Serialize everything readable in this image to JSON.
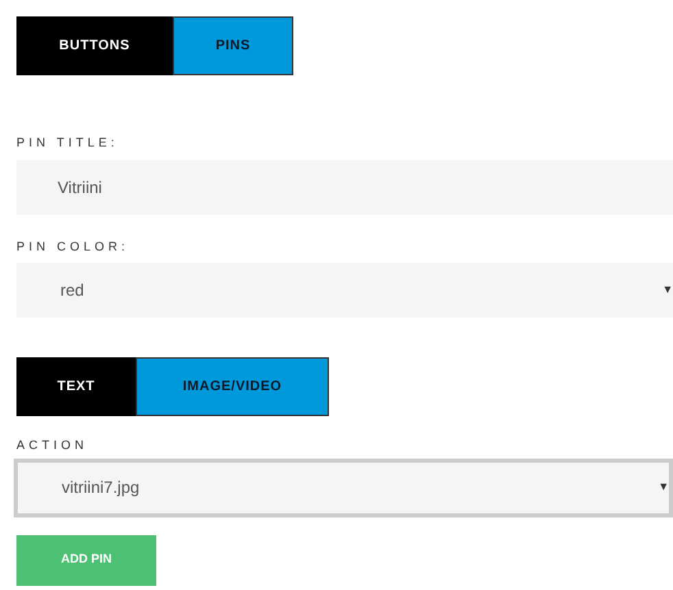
{
  "mode_tabs": [
    {
      "label": "BUTTONS",
      "selected": false
    },
    {
      "label": "PINS",
      "selected": true
    }
  ],
  "pin_title": {
    "label": "PIN TITLE:",
    "value": "Vitriini"
  },
  "pin_color": {
    "label": "PIN COLOR:",
    "value": "red",
    "arrow": "▼"
  },
  "content_tabs": [
    {
      "label": "TEXT",
      "selected": false
    },
    {
      "label": "IMAGE/VIDEO",
      "selected": true
    }
  ],
  "action": {
    "label": "ACTION",
    "value": "vitriini7.jpg",
    "arrow": "▼"
  },
  "add_button": "ADD PIN"
}
